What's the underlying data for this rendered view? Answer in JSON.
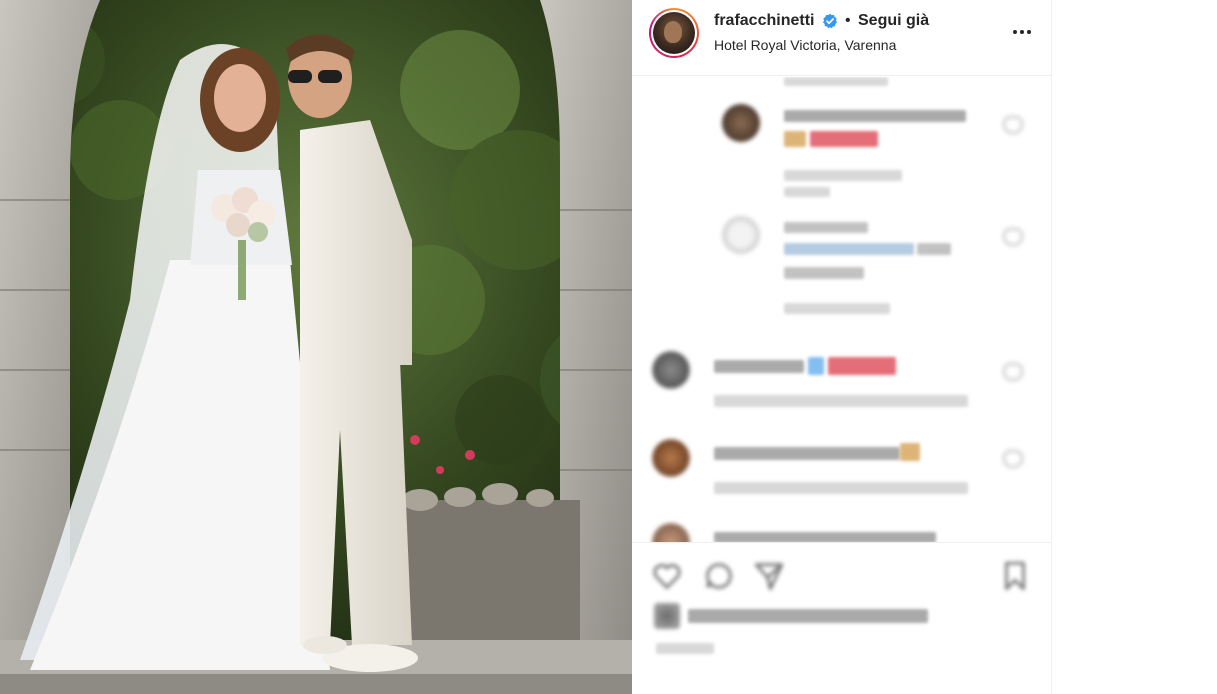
{
  "post": {
    "username": "frafacchinetti",
    "separator": "•",
    "follow_status": "Segui già",
    "location": "Hotel Royal Victoria, Varenna"
  },
  "icons": {
    "verified": "verified-badge-icon",
    "more": "more-options-icon",
    "like": "heart-icon",
    "comment": "comment-bubble-icon",
    "share": "paper-plane-icon",
    "save": "bookmark-icon"
  },
  "colors": {
    "verified_blue": "#3897f0",
    "text": "#262626",
    "divider": "#efefef",
    "story_ring_start": "#f09433",
    "story_ring_end": "#bc1888"
  }
}
